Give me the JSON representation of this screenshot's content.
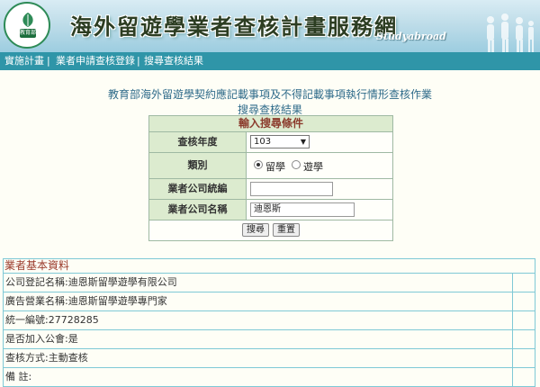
{
  "header": {
    "site_title": "海外留遊學業者查核計畫服務網",
    "tagline": "Studyabroad",
    "logo_text": "MINISTRY OF EDUCATION",
    "logo_badge": "教育部"
  },
  "nav": {
    "items": [
      {
        "label": "實施計畫"
      },
      {
        "label": "業者申請查核登錄"
      },
      {
        "label": "搜尋查核結果"
      }
    ]
  },
  "page": {
    "heading": "教育部海外留遊學契約應記載事項及不得記載事項執行情形查核作業",
    "subheading": "搜尋查核結果"
  },
  "search_form": {
    "title": "輸入搜尋條件",
    "year_label": "查核年度",
    "year_value": "103",
    "category_label": "類別",
    "category_options": [
      "留學",
      "遊學"
    ],
    "category_selected": "留學",
    "tax_id_label": "業者公司統編",
    "tax_id_value": "",
    "company_label": "業者公司名稱",
    "company_value": "迪恩斯",
    "search_button": "搜尋",
    "reset_button": "重置"
  },
  "result": {
    "title": "業者基本資料",
    "rows": [
      "公司登記名稱:迪恩斯留學遊學有限公司",
      "廣告營業名稱:迪恩斯留學遊學專門家",
      "統一編號:27728285",
      "是否加入公會:是",
      "查核方式:主動查核",
      "備 註:"
    ]
  },
  "colors": {
    "nav_bg": "#2f95a8",
    "heading_text": "#2f6b8a",
    "form_title_text": "#8b3b2c",
    "result_border": "#7fc9d6"
  }
}
